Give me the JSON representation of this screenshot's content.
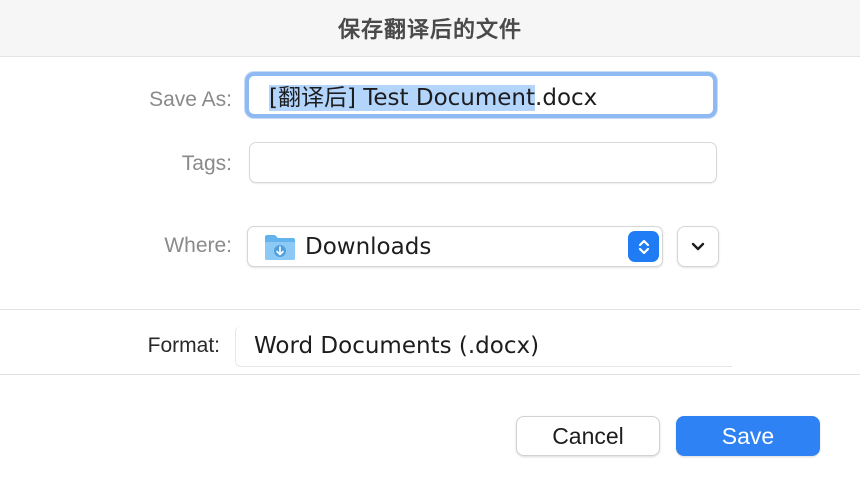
{
  "dialog": {
    "title": "保存翻译后的文件"
  },
  "save_as": {
    "label": "Save As:",
    "value_selected": "[翻译后] Test Document",
    "value_extension": ".docx"
  },
  "tags": {
    "label": "Tags:",
    "value": ""
  },
  "where": {
    "label": "Where:",
    "value": "Downloads",
    "icon": "downloads-folder-icon"
  },
  "format": {
    "label": "Format:",
    "value": "Word Documents (.docx)"
  },
  "buttons": {
    "cancel_label": "Cancel",
    "save_label": "Save"
  },
  "colors": {
    "accent": "#2f82f4",
    "focus_ring": "#8fb9f2",
    "selection": "#b3d4fb"
  }
}
